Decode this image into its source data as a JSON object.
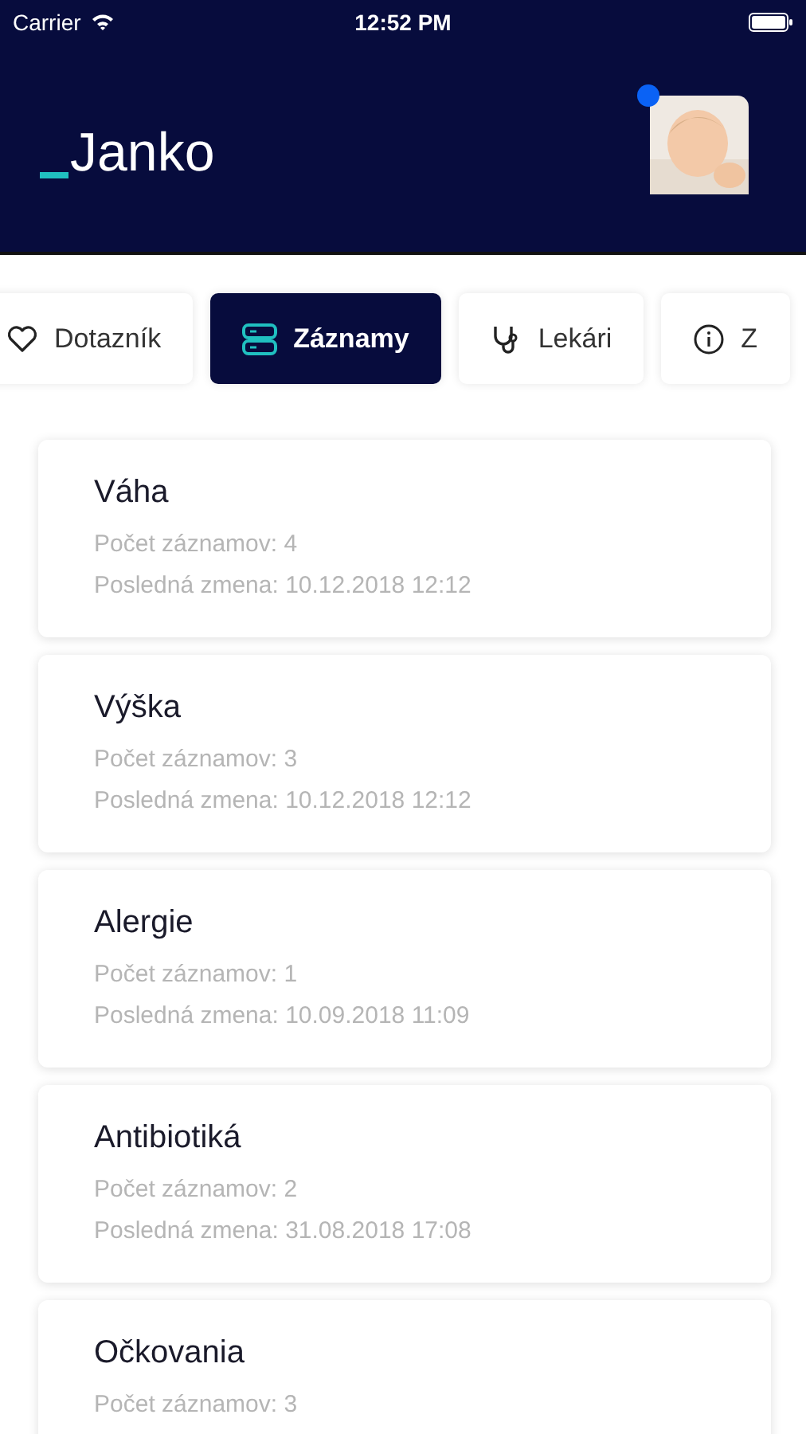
{
  "status_bar": {
    "carrier": "Carrier",
    "time": "12:52 PM"
  },
  "header": {
    "title": "Janko",
    "has_notification": true
  },
  "tabs": [
    {
      "label": "Dotazník",
      "kind": "heart",
      "selected": false
    },
    {
      "label": "Záznamy",
      "kind": "records",
      "selected": true
    },
    {
      "label": "Lekári",
      "kind": "stethoscope",
      "selected": false
    },
    {
      "label": "Z",
      "kind": "info",
      "selected": false
    }
  ],
  "records": [
    {
      "title": "Váha",
      "count": "Počet záznamov: 4",
      "last_change": "Posledná zmena: 10.12.2018 12:12"
    },
    {
      "title": "Výška",
      "count": "Počet záznamov: 3",
      "last_change": "Posledná zmena: 10.12.2018 12:12"
    },
    {
      "title": "Alergie",
      "count": "Počet záznamov: 1",
      "last_change": "Posledná zmena: 10.09.2018 11:09"
    },
    {
      "title": "Antibiotiká",
      "count": "Počet záznamov: 2",
      "last_change": "Posledná zmena: 31.08.2018 17:08"
    },
    {
      "title": "Očkovania",
      "count": "Počet záznamov: 3"
    }
  ]
}
